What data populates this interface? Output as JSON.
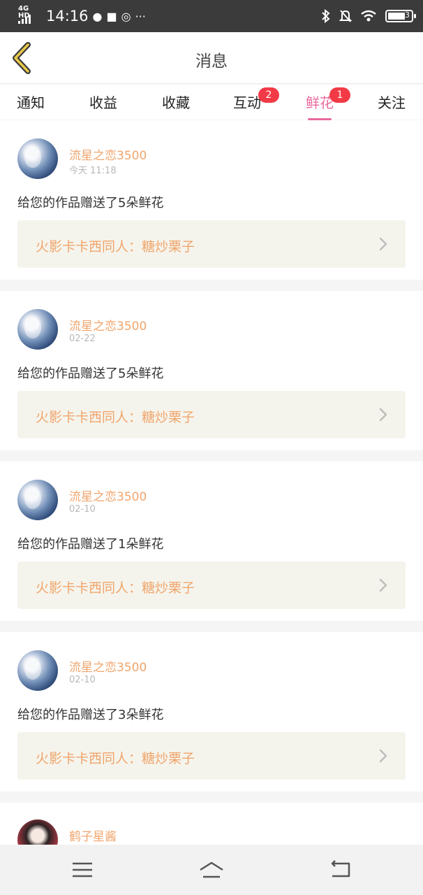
{
  "status_bar": {
    "network": "4G HD",
    "time": "14:16",
    "notif_icons": [
      "chat-bubble-icon",
      "message-icon",
      "app-icon"
    ],
    "more": "···",
    "battery_level": "3"
  },
  "header": {
    "title": "消息",
    "back_icon": "back-chevron-icon"
  },
  "tabs": [
    {
      "label": "通知",
      "badge": "",
      "active": false
    },
    {
      "label": "收益",
      "badge": "",
      "active": false
    },
    {
      "label": "收藏",
      "badge": "",
      "active": false
    },
    {
      "label": "互动",
      "badge": "2",
      "active": false
    },
    {
      "label": "鲜花",
      "badge": "1",
      "active": true
    },
    {
      "label": "关注",
      "badge": "",
      "active": false
    }
  ],
  "messages": [
    {
      "user": "流星之恋3500",
      "time": "今天 11:18",
      "text": "给您的作品赠送了5朵鲜花",
      "work": "火影卡卡西同人：糖炒栗子"
    },
    {
      "user": "流星之恋3500",
      "time": "02-22",
      "text": "给您的作品赠送了5朵鲜花",
      "work": "火影卡卡西同人：糖炒栗子"
    },
    {
      "user": "流星之恋3500",
      "time": "02-10",
      "text": "给您的作品赠送了1朵鲜花",
      "work": "火影卡卡西同人：糖炒栗子"
    },
    {
      "user": "流星之恋3500",
      "time": "02-10",
      "text": "给您的作品赠送了3朵鲜花",
      "work": "火影卡卡西同人：糖炒栗子"
    },
    {
      "user": "鹤子星酱"
    }
  ],
  "colors": {
    "accent": "#e86a9e",
    "badge": "#f23a46",
    "username": "#f0a56d",
    "status_bar": "#3b3b3b"
  },
  "nav_bar": {
    "buttons": [
      "menu-icon",
      "home-icon",
      "back-icon"
    ]
  }
}
